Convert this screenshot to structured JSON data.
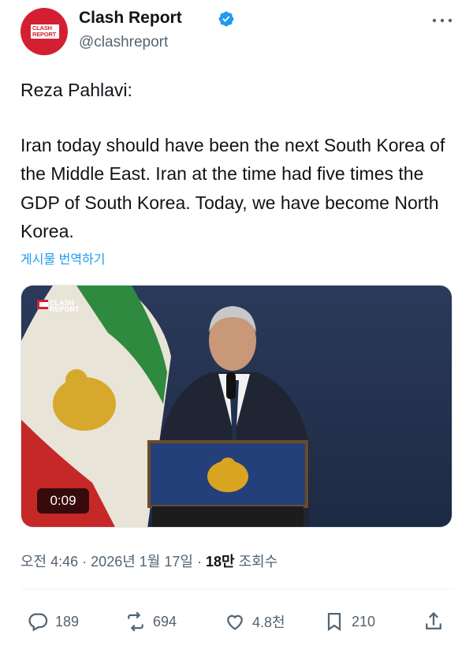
{
  "account": {
    "name": "Clash Report",
    "handle": "@clashreport",
    "avatar_text_line1": "CLASH",
    "avatar_text_line2": "REPORT"
  },
  "post": {
    "paragraph1": "Reza Pahlavi:",
    "paragraph2": "Iran today should have been the next South Korea of the Middle East. Iran at the time had five times the GDP of South Korea. Today, we have become North Korea.",
    "translate_label": "게시물 번역하기"
  },
  "media": {
    "duration": "0:09",
    "watermark_line1": "CLASH",
    "watermark_line2": "REPORT"
  },
  "meta": {
    "time": "오전 4:46",
    "date": "2026년 1월 17일",
    "views_count": "18만",
    "views_label": "조회수"
  },
  "actions": {
    "replies": "189",
    "reposts": "694",
    "likes": "4.8천",
    "bookmarks": "210"
  },
  "colors": {
    "brand_red": "#d41f33",
    "link_blue": "#1d9bf0",
    "muted_gray": "#536471"
  }
}
